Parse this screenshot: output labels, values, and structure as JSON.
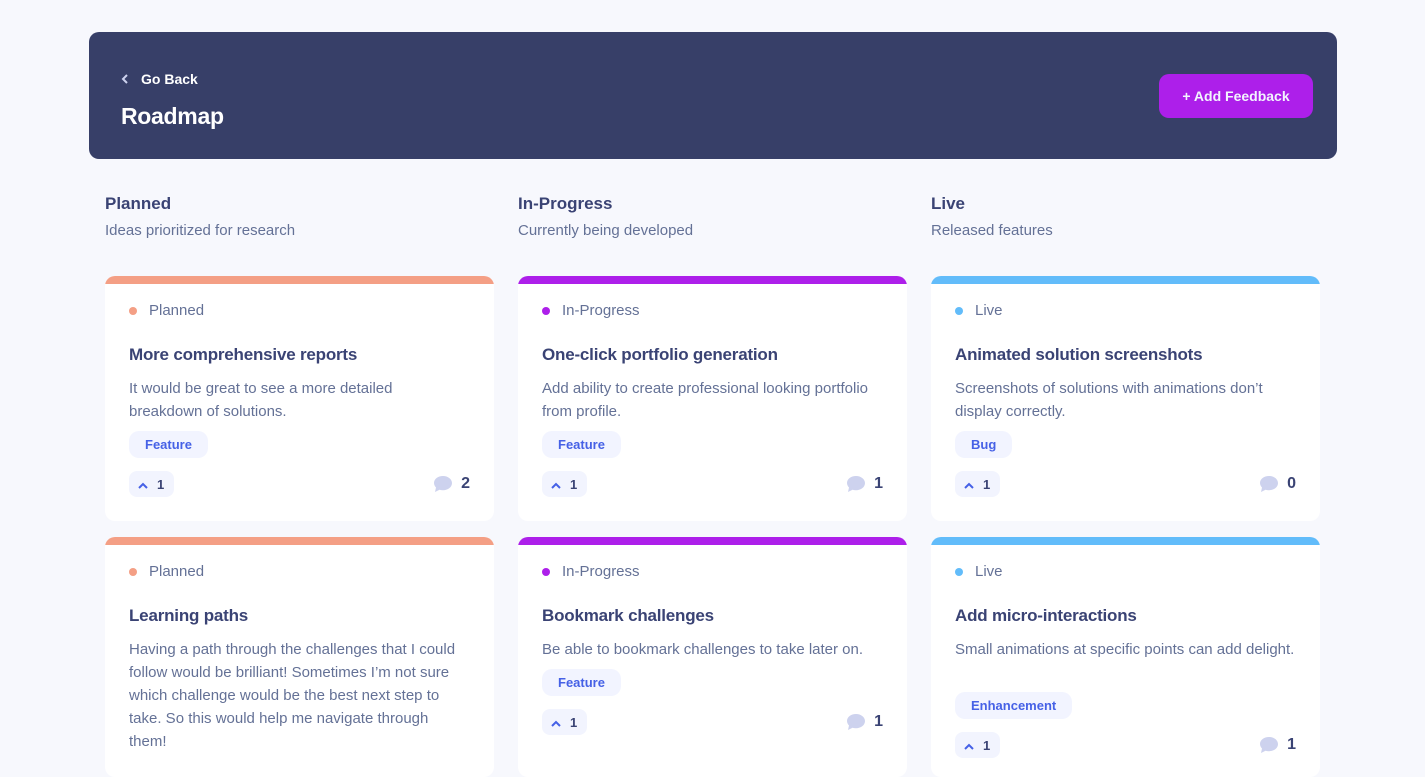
{
  "header": {
    "back_label": "Go Back",
    "title": "Roadmap",
    "add_button": "+ Add Feedback"
  },
  "columns": [
    {
      "title": "Planned",
      "subtitle": "Ideas prioritized for research",
      "color": "#F49F85",
      "cards": [
        {
          "status": "Planned",
          "title": "More comprehensive reports",
          "description": "It would be great to see a more detailed breakdown of solutions.",
          "tag": "Feature",
          "upvotes": "1",
          "comments": "2"
        },
        {
          "status": "Planned",
          "title": "Learning paths",
          "description": "Having a path through the challenges that I could follow would be brilliant! Sometimes I’m not sure which challenge would be the best next step to take. So this would help me navigate through them!"
        }
      ]
    },
    {
      "title": "In-Progress",
      "subtitle": "Currently being developed",
      "color": "#AD1FEA",
      "cards": [
        {
          "status": "In-Progress",
          "title": "One-click portfolio generation",
          "description": "Add ability to create professional looking portfolio from profile.",
          "tag": "Feature",
          "upvotes": "1",
          "comments": "1"
        },
        {
          "status": "In-Progress",
          "title": "Bookmark challenges",
          "description": "Be able to bookmark challenges to take later on.",
          "tag": "Feature",
          "upvotes": "1",
          "comments": "1"
        }
      ]
    },
    {
      "title": "Live",
      "subtitle": "Released features",
      "color": "#62BCFA",
      "cards": [
        {
          "status": "Live",
          "title": "Animated solution screenshots",
          "description": "Screenshots of solutions with animations don’t display correctly.",
          "tag": "Bug",
          "upvotes": "1",
          "comments": "0"
        },
        {
          "status": "Live",
          "title": "Add micro-interactions",
          "description": "Small animations at specific points can add delight.",
          "tag": "Enhancement",
          "upvotes": "1",
          "comments": "1"
        }
      ]
    }
  ],
  "icons": {
    "back": "chevron-left-icon",
    "upvote": "chevron-up-icon",
    "comments": "comment-bubble-icon"
  }
}
